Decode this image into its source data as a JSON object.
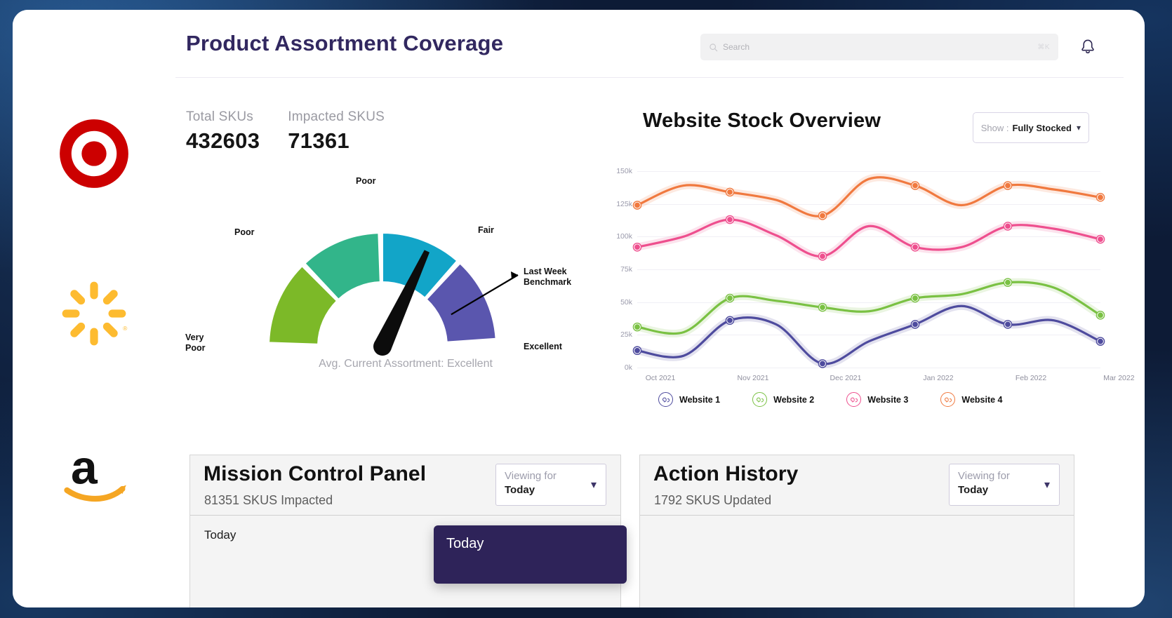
{
  "header": {
    "title": "Product Assortment Coverage",
    "search_placeholder": "Search",
    "search_value": "",
    "search_shortcut": "⌘K",
    "search_icon": "search-icon",
    "bell_icon": "notification-bell-icon"
  },
  "sidebar": {
    "logos": [
      {
        "name": "target-logo",
        "label": "Target"
      },
      {
        "name": "walmart-logo",
        "label": "Walmart"
      },
      {
        "name": "amazon-logo",
        "label": "Amazon"
      }
    ]
  },
  "kpis": [
    {
      "label": "Total SKUs",
      "value": "432603"
    },
    {
      "label": "Impacted SKUS",
      "value": "71361"
    }
  ],
  "gauge": {
    "caption": "Avg. Current Assortment: Excellent",
    "labels": {
      "very_poor": "Very\nPoor",
      "poor_left": "Poor",
      "poor_top": "Poor",
      "fair": "Fair",
      "excellent": "Excellent",
      "benchmark": "Last Week\nBenchmark"
    },
    "segment_colors": [
      "#7cb928",
      "#32b58a",
      "#12a5c8",
      "#5a56ae"
    ],
    "needle_color": "#0c0c0c",
    "needle_angle_deg": 24,
    "benchmark_angle_deg": 132
  },
  "stock": {
    "title": "Website Stock Overview",
    "show_label": "Show :",
    "show_value": "Fully Stocked",
    "chevron_icon": "chevron-down-icon"
  },
  "chart_data": {
    "type": "line",
    "title": "Website Stock Overview",
    "xlabel": "",
    "ylabel": "",
    "ylim": [
      0,
      150000
    ],
    "yticks": [
      0,
      25000,
      50000,
      75000,
      100000,
      125000,
      150000
    ],
    "ytick_labels": [
      "0k",
      "25k",
      "50k",
      "75k",
      "100k",
      "125k",
      "150k"
    ],
    "x": [
      "Oct 2021",
      "Nov 2021",
      "Dec 2021",
      "Jan 2022",
      "Feb 2022",
      "Mar 2022"
    ],
    "xtick_labels": [
      "Oct 2021",
      "Nov 2021",
      "Dec 2021",
      "Jan 2022",
      "Feb 2022",
      "Mar 2022"
    ],
    "grid": true,
    "legend_position": "bottom",
    "series": [
      {
        "name": "Website 1",
        "color": "#4e4b9e",
        "values": [
          13000,
          9000,
          36000,
          33000,
          3000,
          20000,
          33000,
          47000,
          33000,
          36000,
          20000
        ]
      },
      {
        "name": "Website 2",
        "color": "#7ac143",
        "values": [
          31000,
          27000,
          53000,
          51000,
          46000,
          43000,
          53000,
          56000,
          65000,
          61000,
          40000
        ]
      },
      {
        "name": "Website 3",
        "color": "#ee4f8e",
        "values": [
          92000,
          100000,
          113000,
          101000,
          85000,
          108000,
          92000,
          92000,
          108000,
          106000,
          98000
        ]
      },
      {
        "name": "Website 4",
        "color": "#f0793f",
        "values": [
          124000,
          139000,
          134000,
          128000,
          116000,
          144000,
          139000,
          124000,
          139000,
          136000,
          130000
        ]
      }
    ]
  },
  "mission_panel": {
    "title": "Mission Control Panel",
    "subtitle": "81351 SKUS Impacted",
    "select_label": "Viewing for",
    "select_value": "Today",
    "body_text": "Today"
  },
  "action_panel": {
    "title": "Action History",
    "subtitle": "1792 SKUS Updated",
    "select_label": "Viewing for",
    "select_value": "Today",
    "body_text": ""
  },
  "dropdown": {
    "options": [
      "Today"
    ]
  },
  "colors": {
    "brand_purple": "#322860",
    "menu_bg": "#2e2359",
    "panel_bg": "#f4f4f4"
  }
}
